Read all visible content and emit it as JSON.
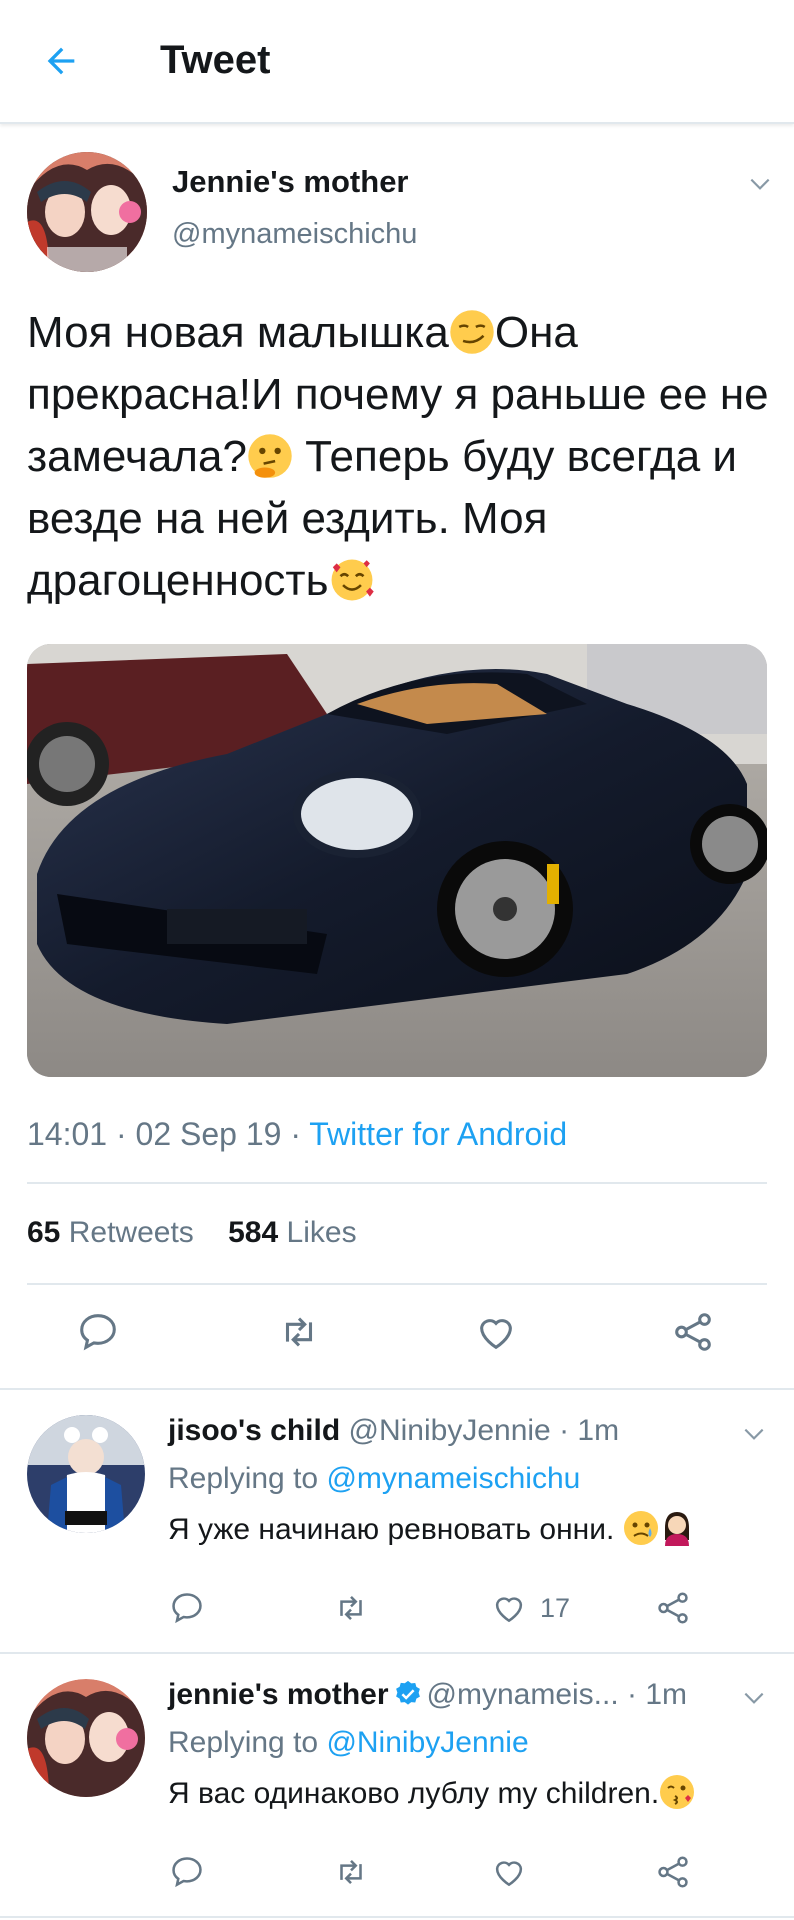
{
  "header": {
    "title": "Tweet",
    "back_icon": "arrow-left-icon"
  },
  "tweet": {
    "author_name": "Jennie's mother",
    "author_handle": "@mynameischichu",
    "text_parts": [
      "Моя новая малышка",
      "Она прекрасна!И почему я раньше ее не замечала?",
      " Теперь буду всегда и везде на ней ездить. Моя драгоценность"
    ],
    "emojis": [
      "smirking-face-emoji",
      "thinking-face-emoji",
      "smiling-face-with-hearts-emoji"
    ],
    "media_alt": "car-photo",
    "time": "14:01",
    "date": "02 Sep 19",
    "source": "Twitter for Android",
    "separator": " · ",
    "retweets_count": "65",
    "retweets_label": "Retweets",
    "likes_count": "584",
    "likes_label": "Likes",
    "actions": [
      "reply-icon",
      "retweet-icon",
      "like-icon",
      "share-icon"
    ]
  },
  "replies": [
    {
      "name": "jisoo's child",
      "handle": "@NinibyJennie",
      "time": "1m",
      "verified": false,
      "replying_label": "Replying to",
      "replying_to": "@mynameischichu",
      "text": "Я уже начинаю ревновать онни.",
      "emojis": [
        "sad-but-relieved-face-emoji",
        "woman-frowning-emoji"
      ],
      "like_count": "17"
    },
    {
      "name": "jennie's mother",
      "handle": "@mynameis...",
      "time": "1m",
      "verified": true,
      "replying_label": "Replying to",
      "replying_to": "@NinibyJennie",
      "text": "Я вас одинаково лублу my children.",
      "emojis": [
        "face-blowing-kiss-emoji"
      ],
      "like_count": ""
    }
  ],
  "colors": {
    "accent": "#1da1f2",
    "text": "#14171a",
    "muted": "#657786",
    "divider": "#e1e8ed"
  }
}
